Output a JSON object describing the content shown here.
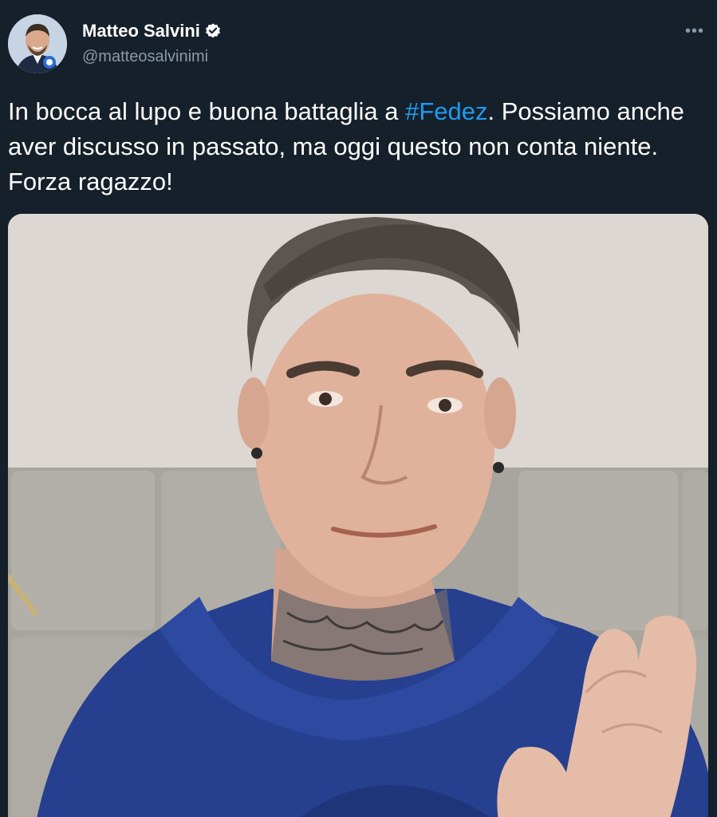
{
  "author": {
    "display_name": "Matteo Salvini",
    "handle": "@matteosalvinimi",
    "verified": true
  },
  "tweet": {
    "text_part1": "In bocca al lupo e buona battaglia a ",
    "hashtag": "#Fedez",
    "text_part2": ". Possiamo anche aver discusso in passato, ma oggi questo non conta niente. Forza ragazzo!"
  },
  "icons": {
    "more": "more-options-icon",
    "verified": "verified-badge-icon"
  },
  "colors": {
    "background": "#15202b",
    "text": "#ffffff",
    "secondary": "#8b98a5",
    "accent": "#1d9bf0"
  }
}
